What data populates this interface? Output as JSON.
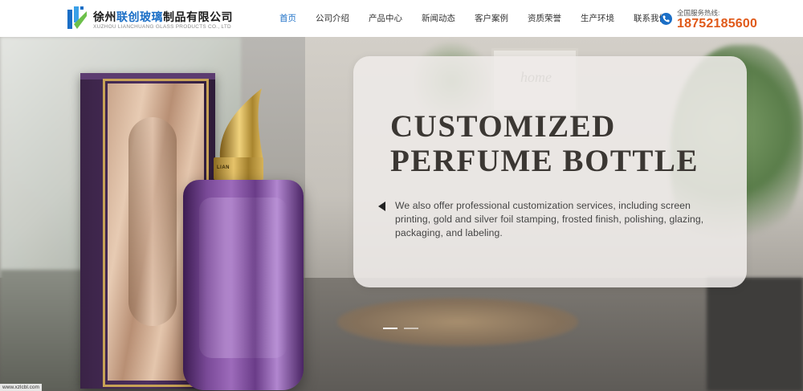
{
  "header": {
    "logo": {
      "company_cn_prefix": "徐州",
      "company_cn_highlight": "联创玻璃",
      "company_cn_suffix": "制品有限公司",
      "company_en": "XUZHOU LIANCHUANG GLASS PRODUCTS CO., LTD"
    },
    "nav": [
      {
        "label": "首页",
        "active": true
      },
      {
        "label": "公司介绍",
        "active": false
      },
      {
        "label": "产品中心",
        "active": false
      },
      {
        "label": "新闻动态",
        "active": false
      },
      {
        "label": "客户案例",
        "active": false
      },
      {
        "label": "资质荣誉",
        "active": false
      },
      {
        "label": "生产环境",
        "active": false
      },
      {
        "label": "联系我们",
        "active": false
      }
    ],
    "phone": {
      "label": "全国服务热线:",
      "number": "18752185600",
      "icon": "phone-icon"
    }
  },
  "hero": {
    "background_text": "home",
    "collar_label": "LIAN",
    "title_line1": "CUSTOMIZED",
    "title_line2": "PERFUME BOTTLE",
    "description": "We also offer professional customization services, including screen printing, gold and silver foil stamping, frosted finish, polishing, glazing, packaging, and labeling.",
    "slides": [
      {
        "active": true
      },
      {
        "active": false
      }
    ],
    "url_tag": "www.xzlcbl.com"
  },
  "colors": {
    "brand_blue": "#1a6ec6",
    "phone_orange": "#e05a1a",
    "title_dark": "#3b3733"
  }
}
